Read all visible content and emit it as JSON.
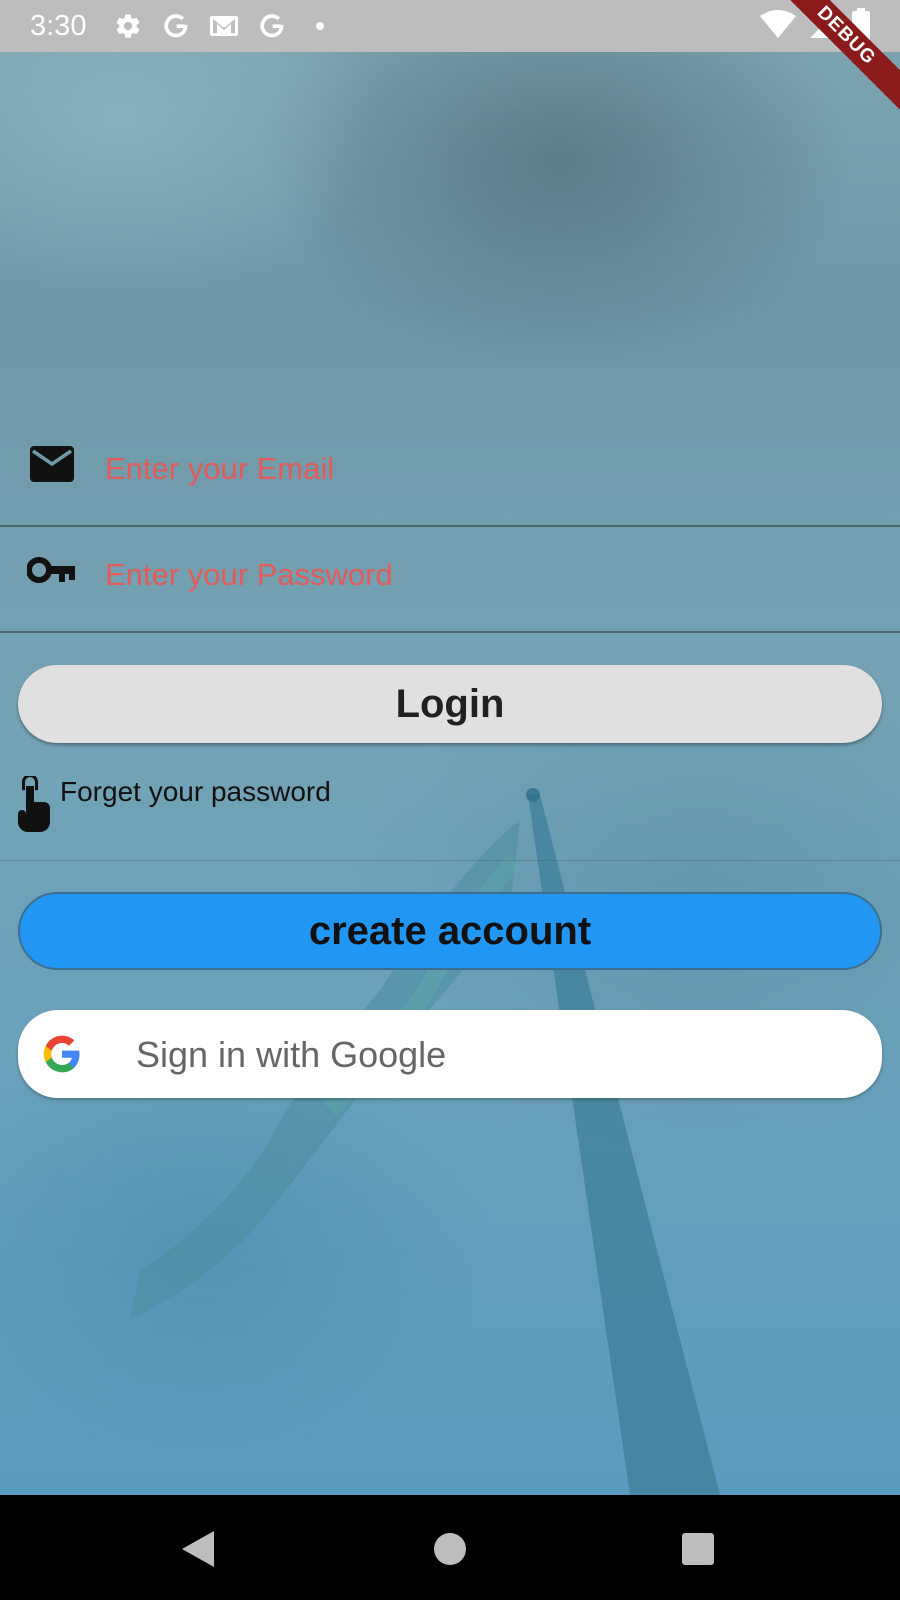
{
  "status_bar": {
    "time": "3:30",
    "left_icons": [
      "gear-icon",
      "google-g-icon",
      "gmail-icon",
      "google-g-icon",
      "dot-icon"
    ],
    "right_icons": [
      "wifi-icon",
      "cell-signal-icon",
      "battery-icon"
    ]
  },
  "debug_banner": {
    "label": "DEBUG",
    "color": "#8b1a1a"
  },
  "form": {
    "email": {
      "placeholder": "Enter your Email",
      "value": "",
      "icon": "mail-icon"
    },
    "password": {
      "placeholder": "Enter your Password",
      "value": "",
      "icon": "key-icon"
    },
    "placeholder_color": "#e25c5c"
  },
  "buttons": {
    "login_label": "Login",
    "forgot_label": "Forget your password",
    "forgot_icon": "touch-hand-icon",
    "create_account_label": "create account",
    "google_label": "Sign in with Google"
  },
  "colors": {
    "create_account_bg": "#2196f3",
    "login_bg": "#e0e0e0",
    "google_bg": "#ffffff",
    "status_bar_bg": "#bdbdbd"
  },
  "nav_bar": {
    "icons": [
      "back-icon",
      "home-icon",
      "recents-icon"
    ]
  }
}
